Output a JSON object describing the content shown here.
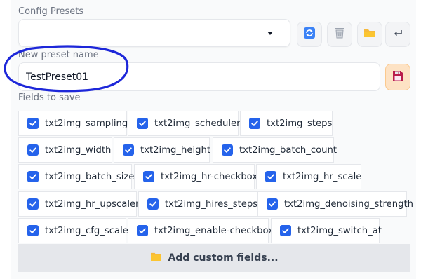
{
  "config_presets": {
    "label": "Config Presets",
    "selected_value": ""
  },
  "toolbar": {
    "refresh_icon": "refresh-icon",
    "delete_icon": "trash-icon",
    "folder_icon": "folder-icon",
    "undo_icon": "return-arrow-icon"
  },
  "new_preset": {
    "label": "New preset name",
    "value": "TestPreset01",
    "save_icon": "floppy-disk-icon"
  },
  "fields": {
    "label": "Fields to save",
    "items": [
      {
        "label": "txt2img_sampling",
        "checked": true
      },
      {
        "label": "txt2img_scheduler",
        "checked": true
      },
      {
        "label": "txt2img_steps",
        "checked": true
      },
      {
        "label": "txt2img_width",
        "checked": true
      },
      {
        "label": "txt2img_height",
        "checked": true
      },
      {
        "label": "txt2img_batch_count",
        "checked": true
      },
      {
        "label": "txt2img_batch_size",
        "checked": true
      },
      {
        "label": "txt2img_hr-checkbox",
        "checked": true
      },
      {
        "label": "txt2img_hr_scale",
        "checked": true
      },
      {
        "label": "txt2img_hr_upscaler",
        "checked": true
      },
      {
        "label": "txt2img_hires_steps",
        "checked": true
      },
      {
        "label": "txt2img_denoising_strength",
        "checked": true
      },
      {
        "label": "txt2img_cfg_scale",
        "checked": true
      },
      {
        "label": "txt2img_enable-checkbox",
        "checked": true
      },
      {
        "label": "txt2img_switch_at",
        "checked": true
      }
    ]
  },
  "add_custom": {
    "label": "Add custom fields...",
    "icon": "folder-icon"
  },
  "colors": {
    "accent": "#2563eb",
    "annotation": "#1d27d9",
    "save_button": "#fde2c4"
  }
}
